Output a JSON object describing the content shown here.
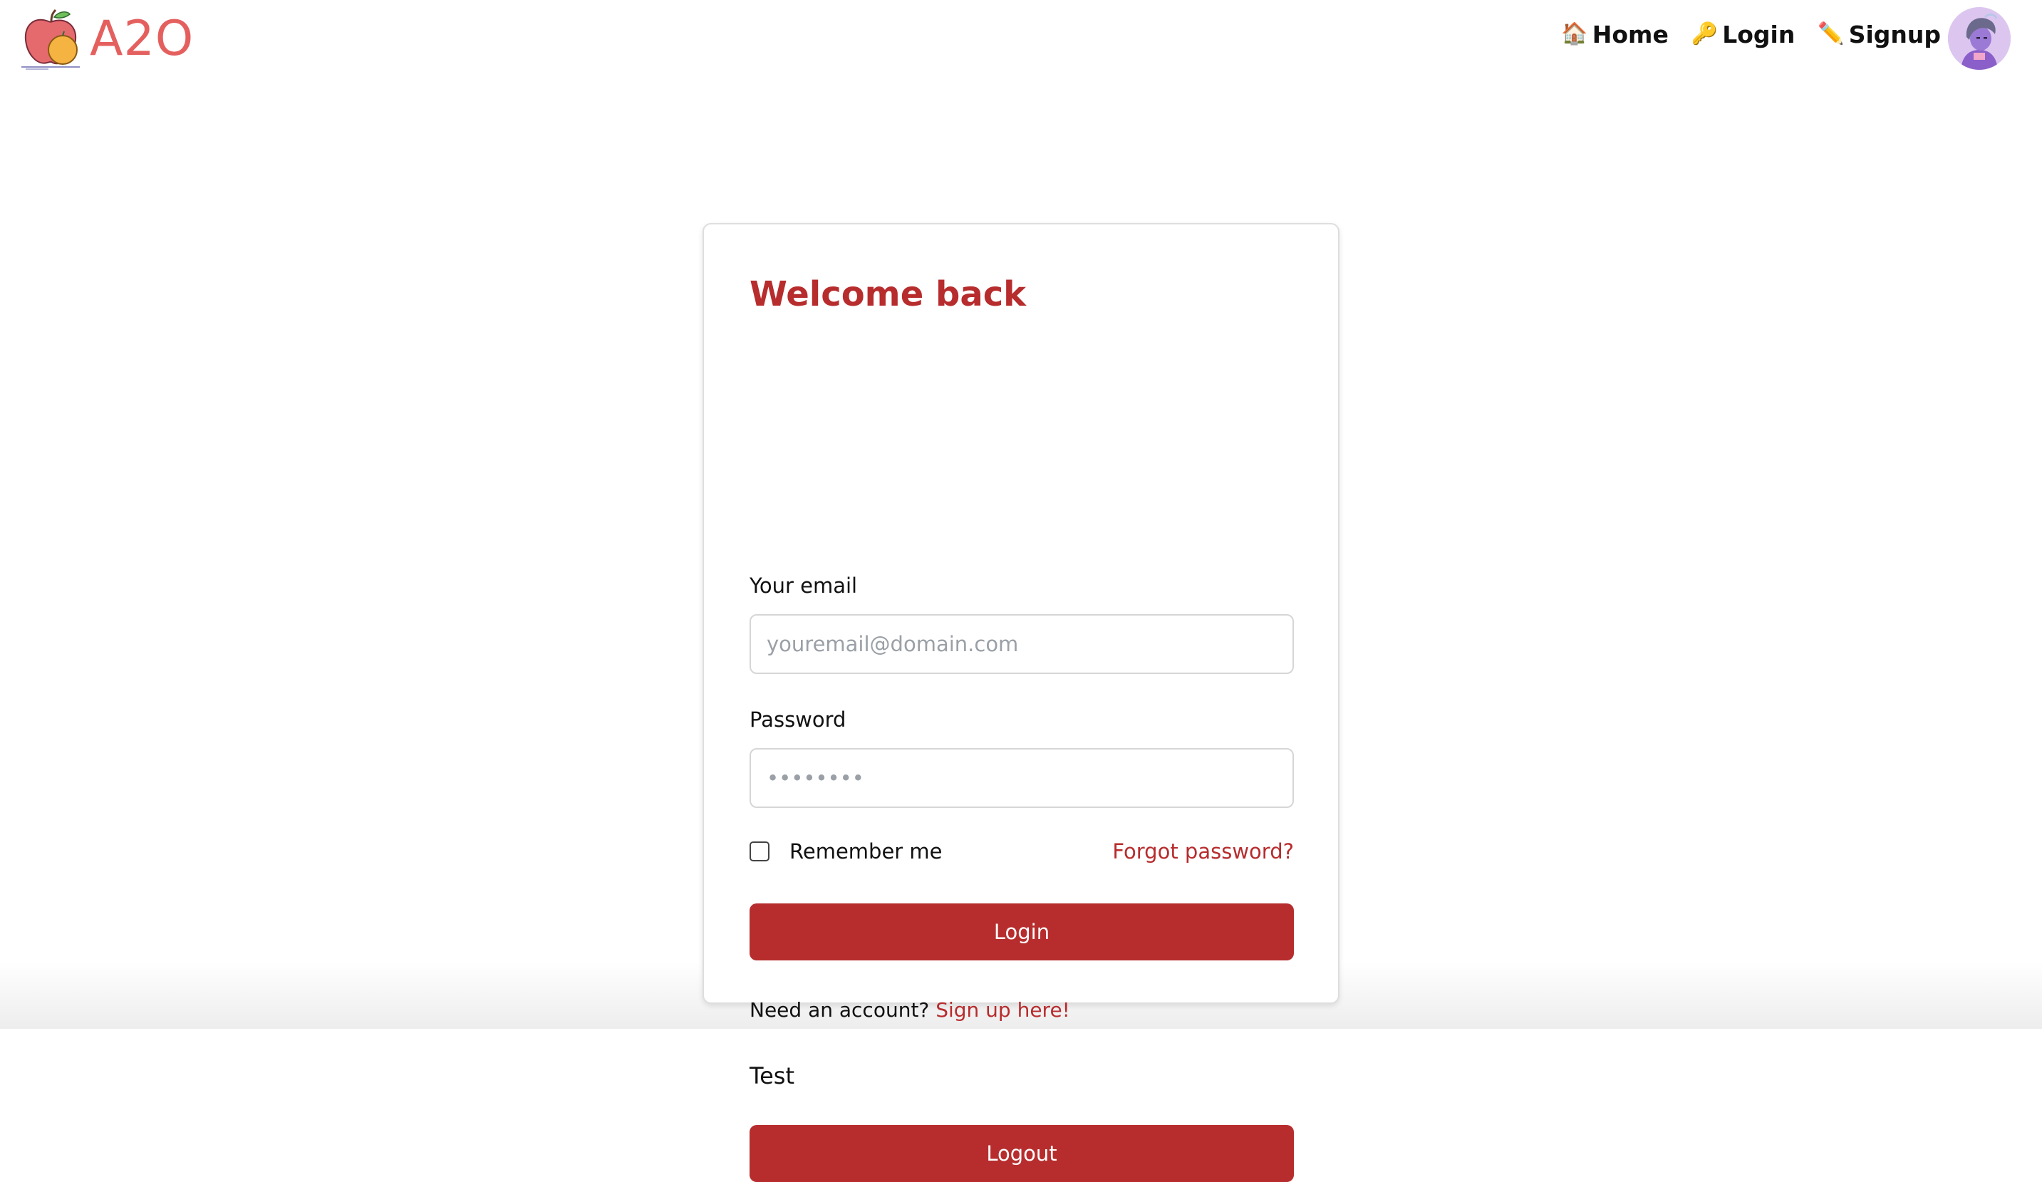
{
  "brand": {
    "name": "A2O",
    "logo_icon": "apple-orange-logo-icon",
    "color": "#e4605e"
  },
  "nav": {
    "items": [
      {
        "icon": "🏠",
        "icon_name": "house-icon",
        "label": "Home"
      },
      {
        "icon": "🔑",
        "icon_name": "key-icon",
        "label": "Login"
      },
      {
        "icon": "✏️",
        "icon_name": "pencil-icon",
        "label": "Signup"
      }
    ],
    "avatar_icon": "user-avatar-icon"
  },
  "login_card": {
    "title": "Welcome back",
    "email_label": "Your email",
    "email_placeholder": "youremail@domain.com",
    "email_value": "",
    "password_label": "Password",
    "password_placeholder": "••••••••",
    "password_value": "",
    "remember_label": "Remember me",
    "remember_checked": false,
    "forgot_link": "Forgot password?",
    "login_button": "Login",
    "signup_prompt": "Need an account?",
    "signup_link": "Sign up here!",
    "test_text": "Test",
    "logout_button": "Logout"
  },
  "colors": {
    "accent": "#b72c2d",
    "border": "#d6d6d6",
    "text": "#111111"
  }
}
